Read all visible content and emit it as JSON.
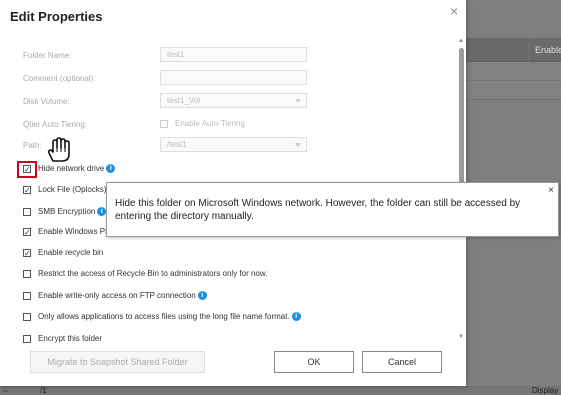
{
  "background": {
    "table_header": "Enable",
    "footer_left": "←",
    "footer_left2": "/1",
    "footer_right": "Display it"
  },
  "dialog": {
    "title": "Edit Properties",
    "close_icon": "×",
    "fields": {
      "folder_name": {
        "label": "Folder Name:",
        "value": "test1"
      },
      "comment": {
        "label": "Comment (optional):",
        "value": ""
      },
      "disk_volume": {
        "label": "Disk Volume:",
        "value": "test1_Vol"
      },
      "qtier": {
        "label": "Qtier Auto Tiering:",
        "checkbox_label": "Enable Auto-Tiering"
      },
      "path": {
        "label": "Path:",
        "value": "/test1"
      }
    },
    "options": [
      {
        "label": "Hide network drive",
        "checked": true,
        "info": true
      },
      {
        "label": "Lock File (Oplocks)",
        "checked": true,
        "info": false
      },
      {
        "label": "SMB Encryption",
        "checked": false,
        "info": true
      },
      {
        "label": "Enable Windows Pr",
        "checked": true,
        "info": false
      },
      {
        "label": "Enable recycle bin",
        "checked": true,
        "info": false
      },
      {
        "label": "Restrict the access of Recycle Bin to administrators only for now.",
        "checked": false,
        "info": false
      },
      {
        "label": "Enable write-only access on FTP connection",
        "checked": false,
        "info": true
      },
      {
        "label": "Only allows applications to access files using the long file name format.",
        "checked": false,
        "info": true
      },
      {
        "label": "Encrypt this folder",
        "checked": false,
        "info": false
      }
    ],
    "buttons": {
      "migrate": "Migrate to Snapshot Shared Folder",
      "ok": "OK",
      "cancel": "Cancel"
    },
    "tooltip": {
      "text": "Hide this folder on Microsoft Windows network. However, the folder can still be accessed by entering the directory manually.",
      "close": "×"
    },
    "check_glyph": "✓",
    "info_glyph": "i",
    "scroll_up": "▲",
    "scroll_down": "▼"
  },
  "colors": {
    "accent": "#1a8fe3",
    "highlight": "#d0021b"
  }
}
